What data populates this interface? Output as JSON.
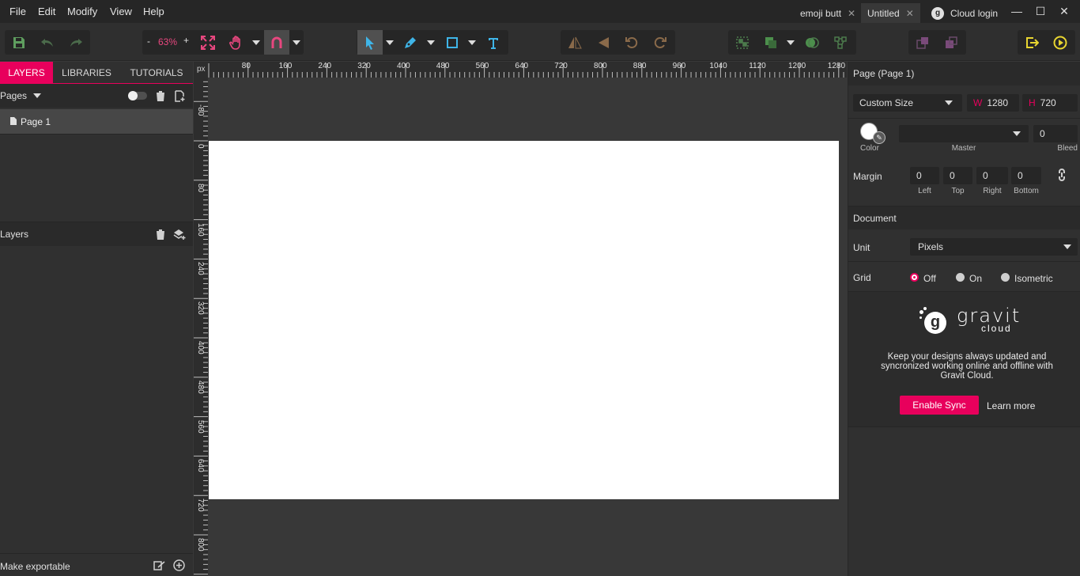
{
  "menu": {
    "file": "File",
    "edit": "Edit",
    "modify": "Modify",
    "view": "View",
    "help": "Help"
  },
  "tabs": [
    {
      "label": "emoji butt"
    },
    {
      "label": "Untitled"
    },
    {
      "label": "Cloud login"
    }
  ],
  "window_controls": {
    "minimize": "—",
    "maximize": "☐",
    "close": "✕"
  },
  "toolbar": {
    "zoom_minus": "-",
    "zoom_value": "63%",
    "zoom_plus": "+"
  },
  "left_panel": {
    "tabs": [
      "LAYERS",
      "LIBRARIES",
      "TUTORIALS"
    ],
    "pages_label": "Pages",
    "pages": [
      "Page 1"
    ],
    "layers_label": "Layers",
    "footer_label": "Make exportable"
  },
  "ruler": {
    "unit": "px",
    "top_ticks": [
      "80",
      "160",
      "240",
      "320",
      "400",
      "480",
      "560",
      "640",
      "720",
      "800",
      "880",
      "960",
      "1040",
      "1120",
      "1200",
      "1280"
    ],
    "left_ticks": [
      "-80",
      "0",
      "80",
      "160",
      "240",
      "320",
      "400",
      "480",
      "560",
      "640",
      "720",
      "800"
    ]
  },
  "right_panel": {
    "page_title": "Page (Page 1)",
    "size_preset": "Custom Size",
    "width_label": "W",
    "width_value": "1280",
    "height_label": "H",
    "height_value": "720",
    "color_label": "Color",
    "master_label": "Master",
    "bleed_label": "Bleed",
    "bleed_value": "0",
    "margin_label": "Margin",
    "margin_left": "0",
    "margin_top": "0",
    "margin_right": "0",
    "margin_bottom": "0",
    "margin_left_label": "Left",
    "margin_top_label": "Top",
    "margin_right_label": "Right",
    "margin_bottom_label": "Bottom",
    "document_title": "Document",
    "unit_label": "Unit",
    "unit_value": "Pixels",
    "grid_label": "Grid",
    "grid_options": [
      "Off",
      "On",
      "Isometric"
    ],
    "grid_selected": "Off",
    "brand_word": "gravit",
    "brand_sub": "cloud",
    "promo_text": "Keep your designs always updated and syncronized working online and offline with Gravit Cloud.",
    "enable_sync": "Enable Sync",
    "learn_more": "Learn more"
  },
  "colors": {
    "accent": "#e8005c",
    "panel": "#303030",
    "canvas": "#383838",
    "artboard": "#ffffff"
  }
}
